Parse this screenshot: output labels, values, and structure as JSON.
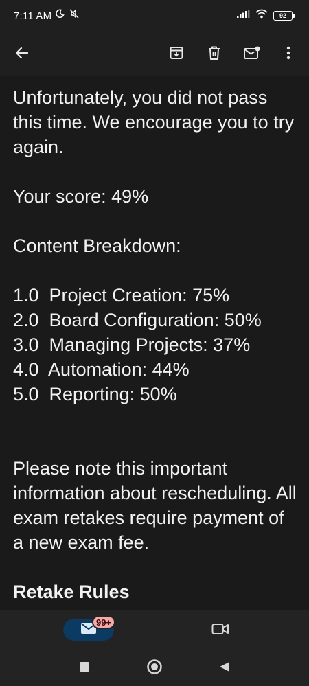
{
  "status_bar": {
    "time": "7:11 AM",
    "battery": "92",
    "icons_left": [
      "moon-icon",
      "mute-icon"
    ],
    "icons_right": [
      "signal-icon",
      "wifi-icon",
      "battery-icon"
    ]
  },
  "toolbar": {
    "icons": [
      "back-arrow-icon",
      "archive-icon",
      "delete-icon",
      "mark-unread-icon",
      "more-vert-icon"
    ]
  },
  "email": {
    "intro": "Unfortunately, you did not pass this time. We encourage you to try again.",
    "score": "Your score:  49%",
    "breakdown_title": "Content Breakdown:",
    "breakdown": [
      "1.0  Project Creation: 75%",
      "2.0  Board Configuration: 50%",
      "3.0  Managing Projects: 37%",
      "4.0  Automation: 44%",
      "5.0  Reporting: 50%"
    ],
    "note": "Please note this important information about rescheduling. All exam retakes require payment of a new exam fee.",
    "retake_heading": "Retake Rules"
  },
  "bottom_nav": {
    "mail_badge": "99+",
    "icons": [
      "mail-icon",
      "video-icon"
    ]
  },
  "system_nav": {
    "icons": [
      "recents-icon",
      "home-icon",
      "back-icon"
    ]
  },
  "colors": {
    "background": "#1a1a1a",
    "bar": "#1f1f1f",
    "nav": "#232323",
    "pill": "#0b3a62",
    "badge": "#f6a8a8",
    "text": "#f2f2f2"
  }
}
